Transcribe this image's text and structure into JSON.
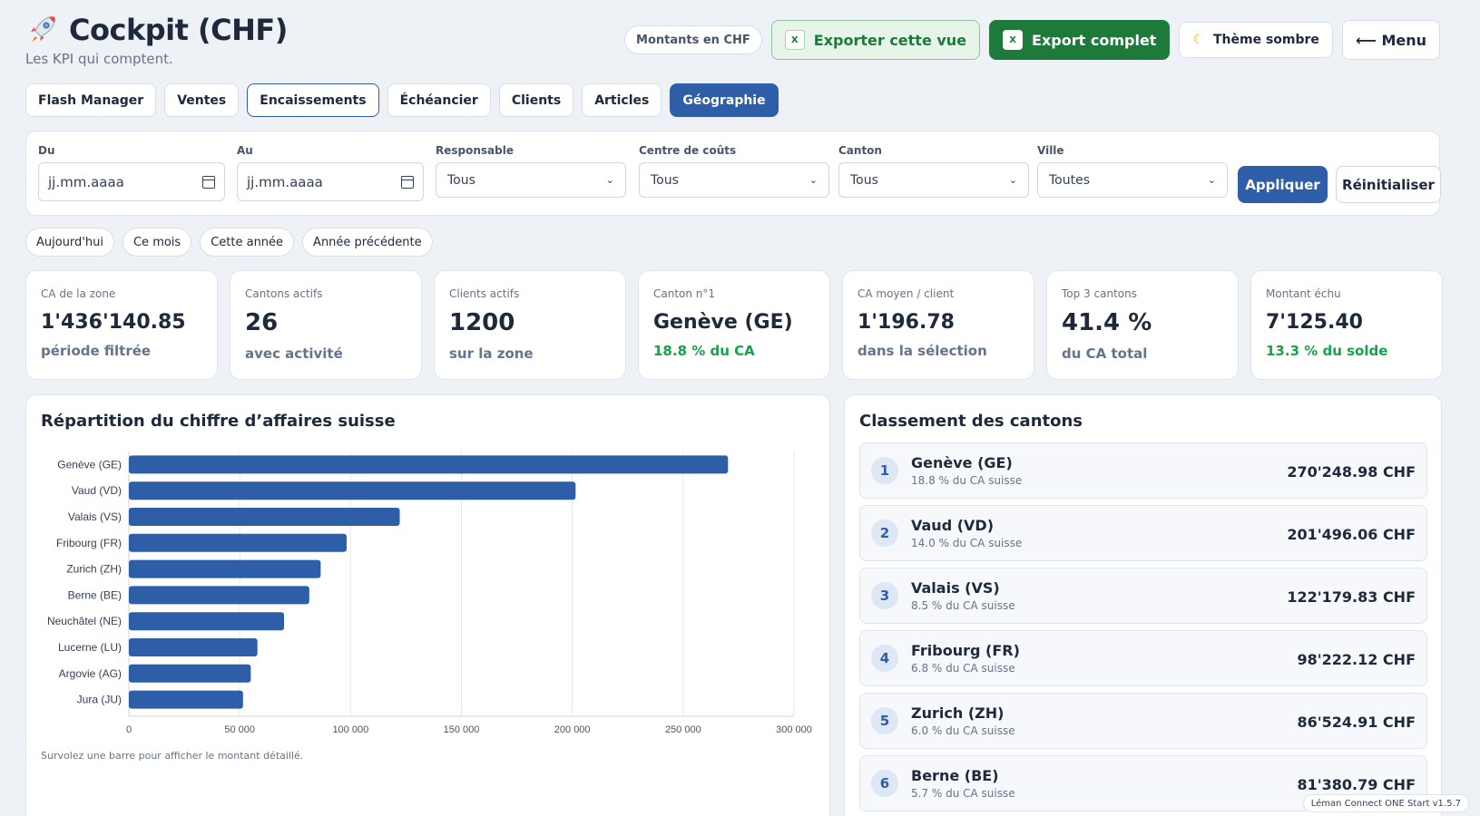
{
  "header": {
    "title": "Cockpit (CHF)",
    "subtitle": "Les KPI qui comptent.",
    "currency_pill": "Montants en CHF",
    "export_view": "Exporter cette vue",
    "export_full": "Export complet",
    "xl_icon": "X",
    "theme": "Thème sombre",
    "menu": "⟵ Menu"
  },
  "tabs": [
    {
      "label": "Flash Manager"
    },
    {
      "label": "Ventes"
    },
    {
      "label": "Encaissements"
    },
    {
      "label": "Échéancier"
    },
    {
      "label": "Clients"
    },
    {
      "label": "Articles"
    },
    {
      "label": "Géographie"
    }
  ],
  "filters": {
    "from": {
      "label": "Du",
      "placeholder": "jj.mm.aaaa"
    },
    "to": {
      "label": "Au",
      "placeholder": "jj.mm.aaaa"
    },
    "manager": {
      "label": "Responsable",
      "value": "Tous"
    },
    "cost_center": {
      "label": "Centre de coûts",
      "value": "Tous"
    },
    "canton": {
      "label": "Canton",
      "value": "Tous"
    },
    "city": {
      "label": "Ville",
      "value": "Toutes"
    },
    "apply": "Appliquer",
    "reset": "Réinitialiser"
  },
  "quick_ranges": [
    "Aujourd'hui",
    "Ce mois",
    "Cette année",
    "Année précédente"
  ],
  "kpis": [
    {
      "label": "CA de la zone",
      "value": "1'436'140.85",
      "sub": "période filtrée"
    },
    {
      "label": "Cantons actifs",
      "value": "26",
      "sub": "avec activité"
    },
    {
      "label": "Clients actifs",
      "value": "1200",
      "sub": "sur la zone"
    },
    {
      "label": "Canton n°1",
      "value": "Genève (GE)",
      "sub": "18.8 % du CA"
    },
    {
      "label": "CA moyen / client",
      "value": "1'196.78",
      "sub": "dans la sélection"
    },
    {
      "label": "Top 3 cantons",
      "value": "41.4 %",
      "sub": "du CA total"
    },
    {
      "label": "Montant échu",
      "value": "7'125.40",
      "sub": "13.3 % du solde"
    }
  ],
  "chart_panel": {
    "title": "Répartition du chiffre d’affaires suisse",
    "note": "Survolez une barre pour afficher le montant détaillé."
  },
  "chart_data": {
    "type": "bar",
    "orientation": "horizontal",
    "categories": [
      "Genève (GE)",
      "Vaud (VD)",
      "Valais (VS)",
      "Fribourg (FR)",
      "Zurich (ZH)",
      "Berne (BE)",
      "Neuchâtel (NE)",
      "Lucerne (LU)",
      "Argovie (AG)",
      "Jura (JU)"
    ],
    "values": [
      270248.98,
      201496.06,
      122179.83,
      98222.12,
      86524.91,
      81380.79,
      70000,
      58000,
      55000,
      51500
    ],
    "xlim": [
      0,
      300000
    ],
    "xticks": [
      "0",
      "50 000",
      "100 000",
      "150 000",
      "200 000",
      "250 000",
      "300 000"
    ],
    "grid": true,
    "bar_color": "#2f5ea8"
  },
  "ranking": {
    "title": "Classement des cantons",
    "items": [
      {
        "rank": "1",
        "name": "Genève (GE)",
        "share": "18.8 % du CA suisse",
        "amount": "270'248.98 CHF"
      },
      {
        "rank": "2",
        "name": "Vaud (VD)",
        "share": "14.0 % du CA suisse",
        "amount": "201'496.06 CHF"
      },
      {
        "rank": "3",
        "name": "Valais (VS)",
        "share": "8.5 % du CA suisse",
        "amount": "122'179.83 CHF"
      },
      {
        "rank": "4",
        "name": "Fribourg (FR)",
        "share": "6.8 % du CA suisse",
        "amount": "98'222.12 CHF"
      },
      {
        "rank": "5",
        "name": "Zurich (ZH)",
        "share": "6.0 % du CA suisse",
        "amount": "86'524.91 CHF"
      },
      {
        "rank": "6",
        "name": "Berne (BE)",
        "share": "5.7 % du CA suisse",
        "amount": "81'380.79 CHF"
      }
    ]
  },
  "version": "Léman Connect ONE Start v1.5.7",
  "colors": {
    "accent": "#2f5ea8",
    "excel_green": "#1d7a3a",
    "positive": "#16a34a",
    "background": "#eef2f7"
  }
}
